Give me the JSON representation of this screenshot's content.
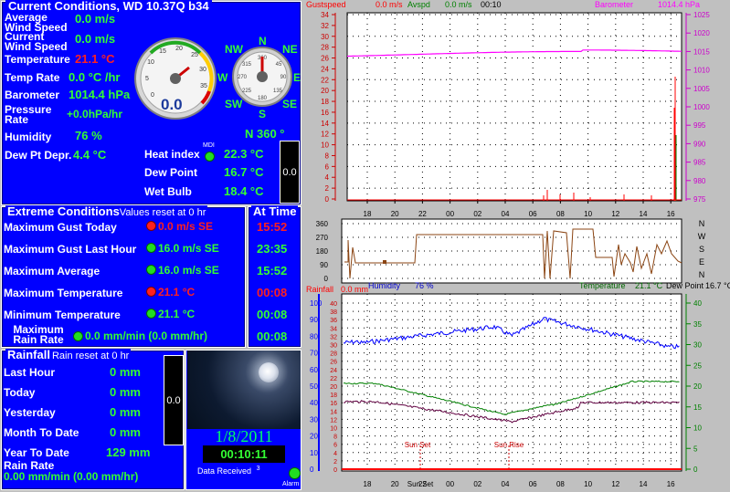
{
  "current": {
    "title": "Current Conditions, WD 10.37Q b34",
    "rows": [
      {
        "label": "Average Wind Speed",
        "value": "0.0 m/s"
      },
      {
        "label": "Current Wind Speed",
        "value": "0.0 m/s"
      },
      {
        "label": "Temperature",
        "value": "21.1 °C"
      },
      {
        "label": "Temp Rate",
        "value": "0.0 °C /hr"
      },
      {
        "label": "Barometer",
        "value": "1014.4 hPa"
      },
      {
        "label": "Pressure Rate",
        "value": "+0.0hPa/hr"
      },
      {
        "label": "Humidity",
        "value": "76 %"
      },
      {
        "label": "Dew Pt Depr.",
        "value": "4.4 °C"
      }
    ],
    "heat_index_label": "Heat index",
    "heat_index_value": "22.3 °C",
    "dew_point_label": "Dew Point",
    "dew_point_value": "16.7 °C",
    "wet_bulb_label": "Wet Bulb",
    "wet_bulb_value": "18.4 °C",
    "wind_dir": "N  360 °",
    "mdi": "MDI",
    "mini_box": "0.0",
    "gauge_speed": "0.0",
    "compass": {
      "n": "N",
      "ne": "NE",
      "e": "E",
      "se": "SE",
      "s": "S",
      "sw": "SW",
      "w": "W",
      "nw": "NW"
    }
  },
  "extreme": {
    "title": "Extreme Conditions",
    "subtitle": "Values reset at 0 hr",
    "at_time_title": "At Time",
    "rows": [
      {
        "label": "Maximum Gust Today",
        "value": "0.0 m/s SE",
        "time": "15:52",
        "red": true
      },
      {
        "label": "Maximum Gust Last Hour",
        "value": "16.0 m/s  SE",
        "time": "23:35",
        "red": false
      },
      {
        "label": "Maximum Average",
        "value": "16.0 m/s SE",
        "time": "15:52",
        "red": false
      },
      {
        "label": "Maximum Temperature",
        "value": "21.1 °C",
        "time": "00:08",
        "red": true
      },
      {
        "label": "Minimum Temperature",
        "value": "21.1 °C",
        "time": "00:08",
        "red": false
      },
      {
        "label": "Maximum Rain Rate",
        "value": "0.0 mm/min (0.0 mm/hr)",
        "time": "00:08",
        "red": false
      }
    ]
  },
  "rain": {
    "title": "Rainfall",
    "subtitle": "Rain reset at 0 hr",
    "rows": [
      {
        "label": "Last Hour",
        "value": "0 mm"
      },
      {
        "label": "Today",
        "value": "0 mm"
      },
      {
        "label": "Yesterday",
        "value": "0 mm"
      },
      {
        "label": "Month To Date",
        "value": "0 mm"
      },
      {
        "label": "Year To Date",
        "value": "129 mm"
      }
    ],
    "rate_label": "Rain Rate",
    "rate_value": "0.00 mm/min (0.00 mm/hr)",
    "mini_box": "0.0"
  },
  "status": {
    "date": "1/8/2011",
    "time": "00:10:11",
    "data_received": "Data Received",
    "data_received_count": "3",
    "alarm": "Alarm"
  },
  "graph1": {
    "legend_gust": "Gustspeed",
    "legend_gust_value": "0.0 m/s",
    "legend_avg": "Avspd",
    "legend_avg_value": "0.0 m/s",
    "legend_time": "00:10",
    "legend_baro": "Barometer",
    "legend_baro_value": "1014.4 hPa",
    "y_left": [
      "34",
      "32",
      "30",
      "28",
      "26",
      "24",
      "22",
      "20",
      "18",
      "16",
      "14",
      "12",
      "10",
      "8",
      "6",
      "4",
      "2",
      "0"
    ],
    "y_right": [
      "1025",
      "1020",
      "1015",
      "1010",
      "1005",
      "1000",
      "995",
      "990",
      "985",
      "980",
      "975"
    ],
    "x_labels": [
      "18",
      "20",
      "22",
      "00",
      "02",
      "04",
      "06",
      "08",
      "10",
      "12",
      "14",
      "16"
    ]
  },
  "graph2": {
    "y_left": [
      "360",
      "270",
      "180",
      "90",
      "0"
    ],
    "compass_right": [
      "N",
      "W",
      "S",
      "E",
      "N"
    ],
    "legend_hum": "Humidity",
    "legend_hum_value": "76 %",
    "legend_temp": "Temperature",
    "legend_temp_value": "21.1 °C",
    "legend_dew": "Dew Point",
    "legend_dew_value": "16.7 °C"
  },
  "graph3": {
    "legend_rain": "Rainfall",
    "legend_rain_value": "0.0 mm",
    "y_left": [
      "100",
      "90",
      "80",
      "70",
      "60",
      "50",
      "40",
      "30",
      "20",
      "10",
      "0"
    ],
    "y_left2": [
      "40",
      "38",
      "36",
      "34",
      "32",
      "30",
      "28",
      "26",
      "24",
      "22",
      "20",
      "18",
      "16",
      "14",
      "12",
      "10",
      "8",
      "6",
      "4",
      "2",
      "0"
    ],
    "y_right": [
      "40",
      "35",
      "30",
      "25",
      "20",
      "15",
      "10",
      "5",
      "0"
    ],
    "x_labels": [
      "18",
      "20",
      "22",
      "00",
      "02",
      "04",
      "06",
      "08",
      "10",
      "12",
      "14",
      "16"
    ],
    "sun_set": "Sun Set",
    "sun_rise": "Sun Rise",
    "sun_set_axis": "Sun Set"
  },
  "colors": {
    "panel_blue": "#0000ff",
    "value_green": "#33ff33",
    "value_red": "#ff2020",
    "gust_red": "#ff0000",
    "baro_magenta": "#ff00ff",
    "wind_dir_brown": "#8b4513",
    "humidity_blue": "#0000ff",
    "temp_green": "#008000",
    "dew_purple": "#600040"
  }
}
